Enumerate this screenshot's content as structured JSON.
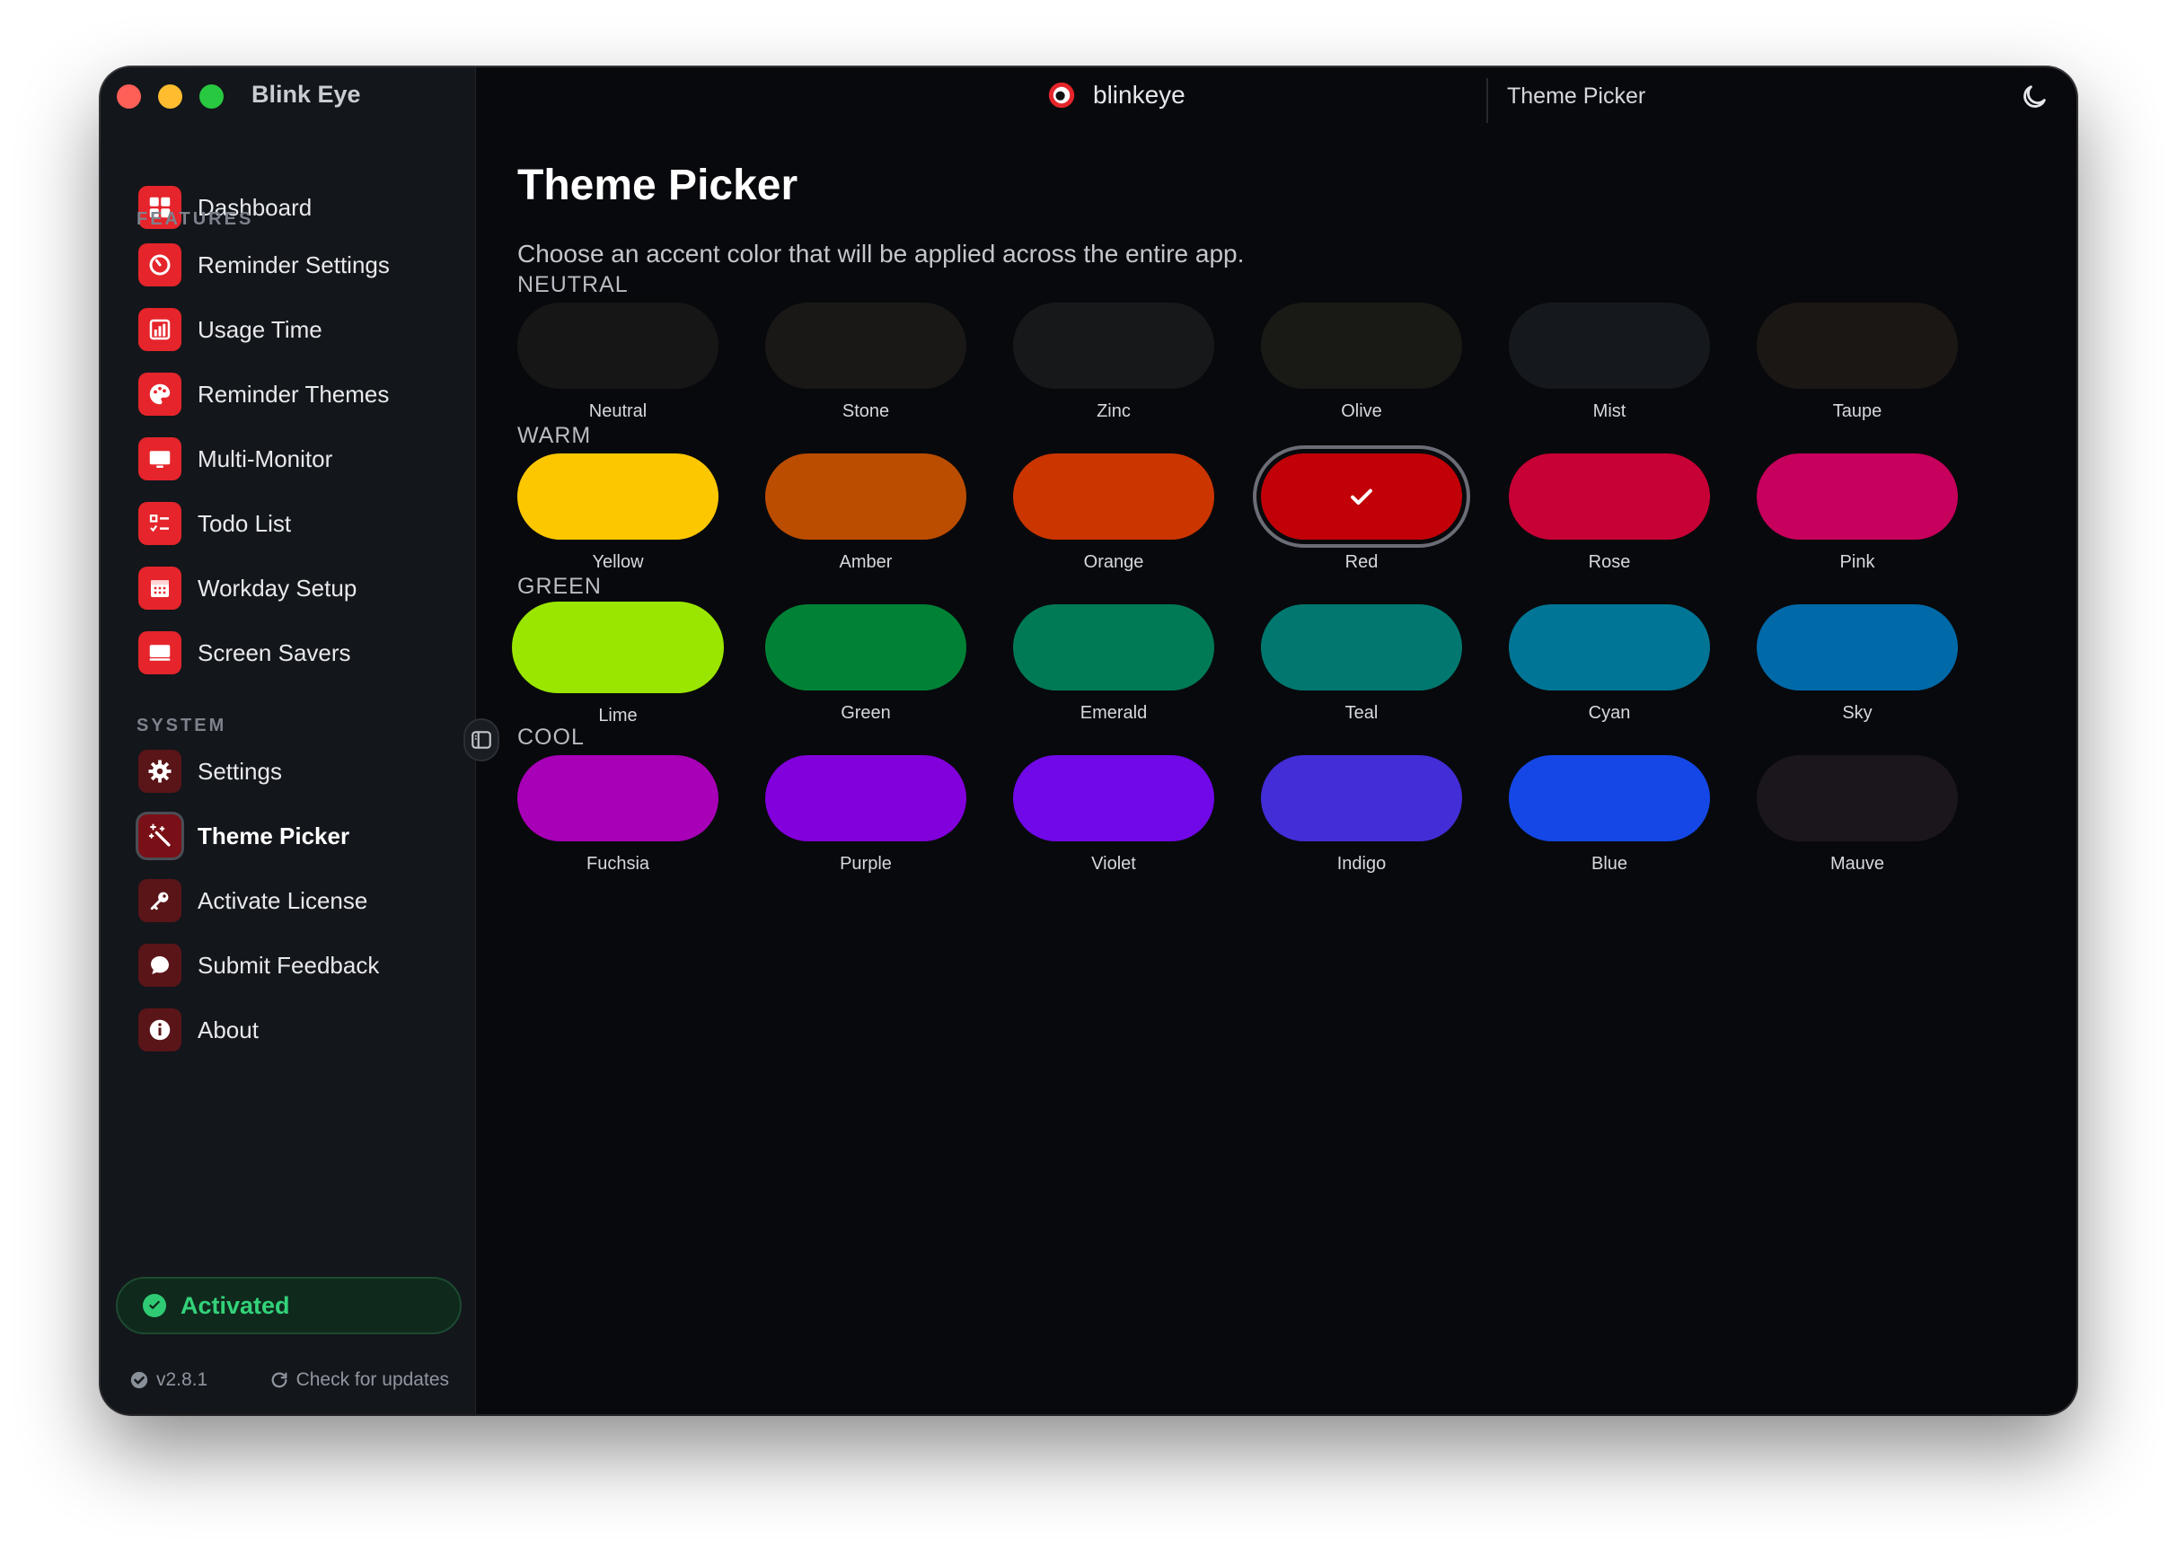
{
  "app": {
    "name": "Blink Eye",
    "brand": "blinkeye",
    "current_page": "Theme Picker"
  },
  "sidebar": {
    "top": {
      "label": "Dashboard",
      "icon": "dashboard-icon"
    },
    "features_label": "FEATURES",
    "features": [
      {
        "label": "Reminder Settings",
        "icon": "timer-icon"
      },
      {
        "label": "Usage Time",
        "icon": "bar-chart-icon"
      },
      {
        "label": "Reminder Themes",
        "icon": "palette-icon"
      },
      {
        "label": "Multi-Monitor",
        "icon": "monitor-icon"
      },
      {
        "label": "Todo List",
        "icon": "checklist-icon"
      },
      {
        "label": "Workday Setup",
        "icon": "calendar-icon"
      },
      {
        "label": "Screen Savers",
        "icon": "screen-icon"
      }
    ],
    "system_label": "SYSTEM",
    "system": [
      {
        "label": "Settings",
        "icon": "gear-icon"
      },
      {
        "label": "Theme Picker",
        "icon": "magic-wand-icon"
      },
      {
        "label": "Activate License",
        "icon": "key-icon"
      },
      {
        "label": "Submit Feedback",
        "icon": "chat-bubble-icon"
      },
      {
        "label": "About",
        "icon": "info-icon"
      }
    ],
    "status": "Activated",
    "version": "v2.8.1",
    "check_updates": "Check for updates"
  },
  "main": {
    "title": "Theme Picker",
    "description": "Choose an accent color that will be applied across the entire app.",
    "selected": "Red",
    "groups": [
      {
        "label": "NEUTRAL",
        "swatches": [
          {
            "name": "Neutral",
            "color": "#161616"
          },
          {
            "name": "Stone",
            "color": "#1a1816"
          },
          {
            "name": "Zinc",
            "color": "#17181a"
          },
          {
            "name": "Olive",
            "color": "#191a15"
          },
          {
            "name": "Mist",
            "color": "#15181c"
          },
          {
            "name": "Taupe",
            "color": "#1b1715"
          }
        ]
      },
      {
        "label": "WARM",
        "swatches": [
          {
            "name": "Yellow",
            "color": "#fdc700"
          },
          {
            "name": "Amber",
            "color": "#bb4d00"
          },
          {
            "name": "Orange",
            "color": "#ca3500"
          },
          {
            "name": "Red",
            "color": "#c10007"
          },
          {
            "name": "Rose",
            "color": "#c70036"
          },
          {
            "name": "Pink",
            "color": "#c6005c"
          }
        ]
      },
      {
        "label": "GREEN",
        "swatches": [
          {
            "name": "Lime",
            "color": "#9ae600"
          },
          {
            "name": "Green",
            "color": "#008236"
          },
          {
            "name": "Emerald",
            "color": "#007a55"
          },
          {
            "name": "Teal",
            "color": "#00786f"
          },
          {
            "name": "Cyan",
            "color": "#007595"
          },
          {
            "name": "Sky",
            "color": "#0069a8"
          }
        ]
      },
      {
        "label": "COOL",
        "swatches": [
          {
            "name": "Fuchsia",
            "color": "#a800b7"
          },
          {
            "name": "Purple",
            "color": "#8200db"
          },
          {
            "name": "Violet",
            "color": "#7008e7"
          },
          {
            "name": "Indigo",
            "color": "#432dd7"
          },
          {
            "name": "Blue",
            "color": "#1447e6"
          },
          {
            "name": "Mauve",
            "color": "#1a161b"
          }
        ]
      }
    ]
  }
}
